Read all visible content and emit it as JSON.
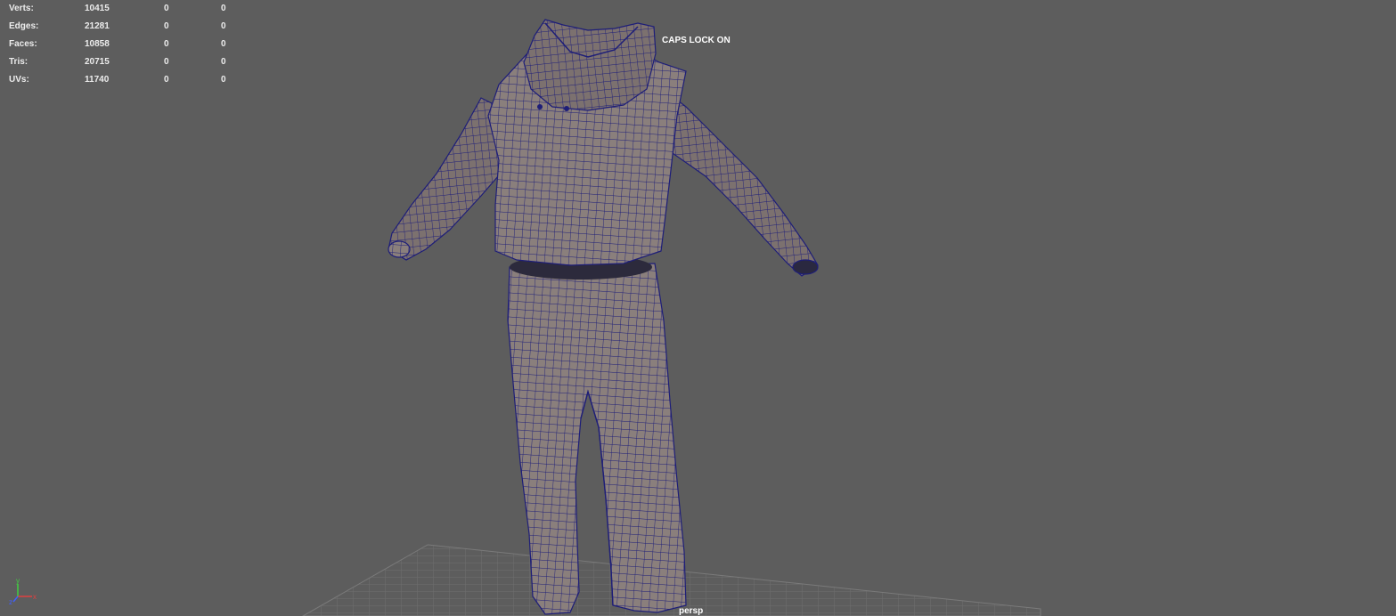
{
  "hud": {
    "stats": [
      {
        "label": "Verts:",
        "v1": "10415",
        "v2": "0",
        "v3": "0"
      },
      {
        "label": "Edges:",
        "v1": "21281",
        "v2": "0",
        "v3": "0"
      },
      {
        "label": "Faces:",
        "v1": "10858",
        "v2": "0",
        "v3": "0"
      },
      {
        "label": "Tris:",
        "v1": "20715",
        "v2": "0",
        "v3": "0"
      },
      {
        "label": "UVs:",
        "v1": "11740",
        "v2": "0",
        "v3": "0"
      }
    ],
    "caps_lock": "CAPS LOCK ON"
  },
  "viewport": {
    "camera": "persp",
    "background": "#5d5d5d",
    "model_color": "#8a7f7c",
    "wireframe_color": "#1e1e78",
    "grid_color": "#777777"
  },
  "axis": {
    "y_label": "y",
    "x_label": "x",
    "z_label": "z",
    "x_color": "#e04040",
    "y_color": "#40d040",
    "z_color": "#4060ff"
  }
}
